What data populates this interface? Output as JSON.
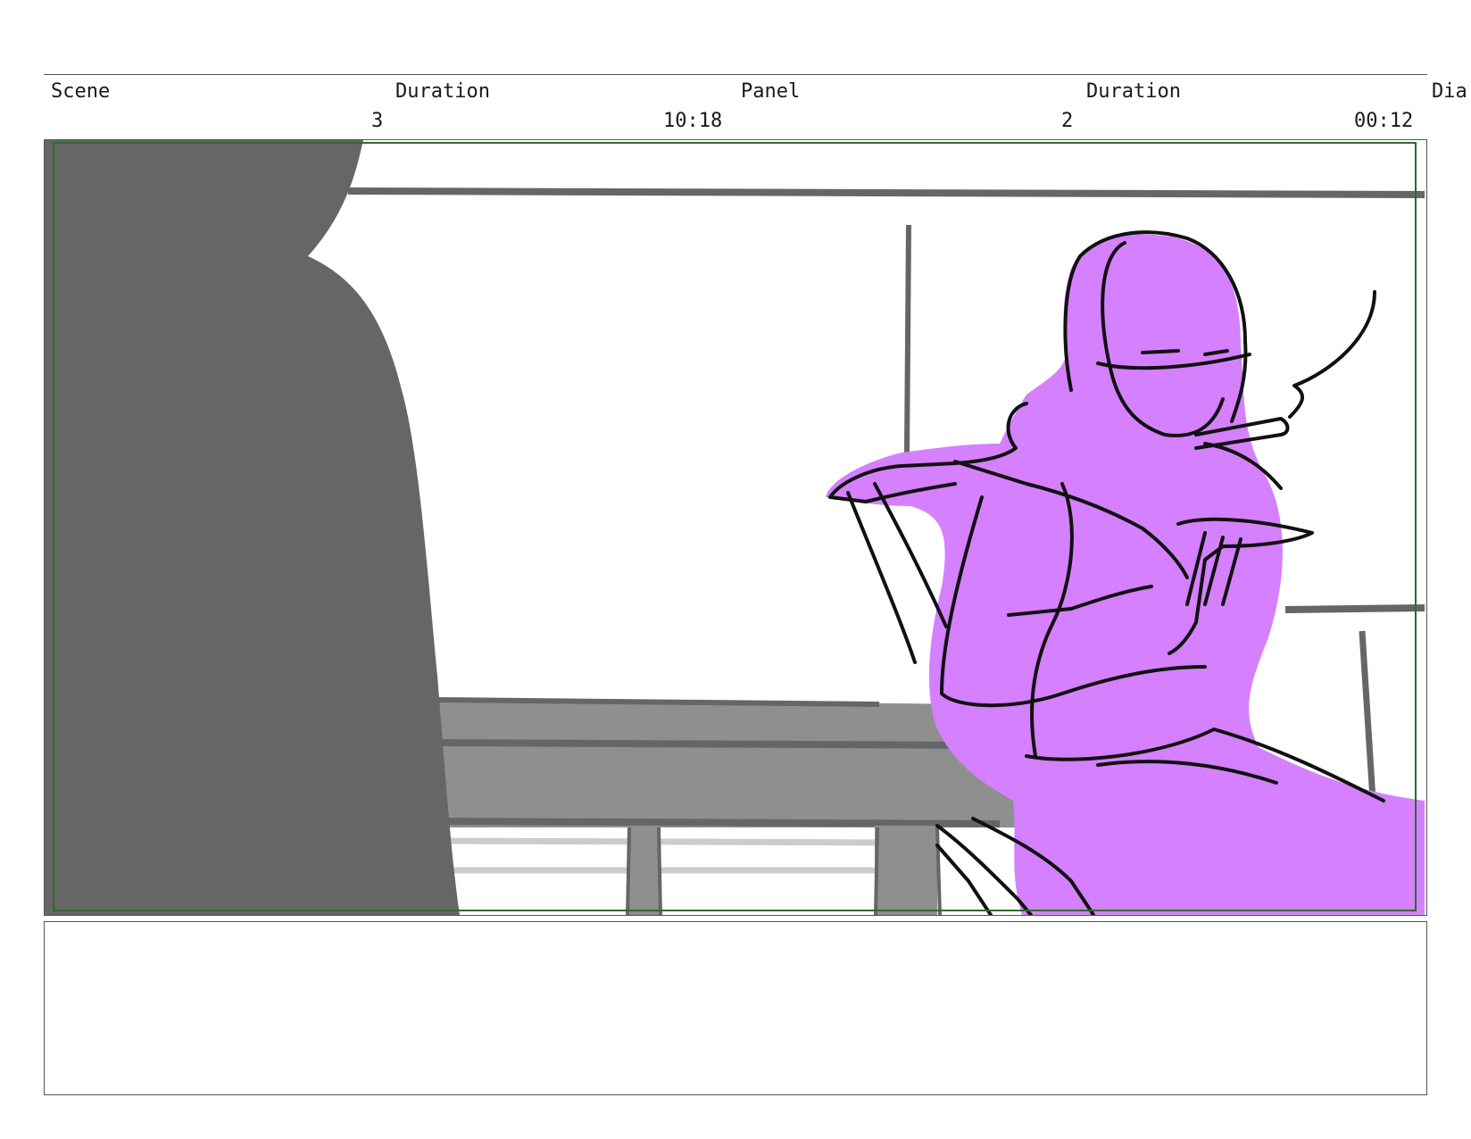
{
  "header": {
    "scene_label": "Scene",
    "scene_duration_label": "Duration",
    "panel_label": "Panel",
    "panel_duration_label": "Duration",
    "dialogue_label": "Dia",
    "scene_value": "3",
    "scene_duration_value": "10:18",
    "panel_value": "2",
    "panel_duration_value": "00:12"
  },
  "panel": {
    "safe_area_color": "#2e6b2e",
    "silhouette_color": "#666666",
    "table_color": "#8f8f8f",
    "figure_color": "#d580ff",
    "line_color": "#111111"
  },
  "notes": {
    "text": ""
  }
}
